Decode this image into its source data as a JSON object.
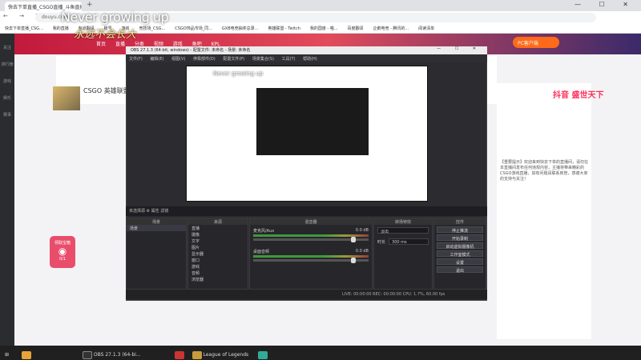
{
  "browser": {
    "tab_title": "快去下单直播_CSGO直播_斗鱼直播",
    "new_tab": "+",
    "window_controls": "— ☐ ✕",
    "nav_buttons": "← → ↻",
    "url": "douyu.com",
    "bookmarks": [
      "快去下单直播_CSG...",
      "我的直播",
      "有道翻译",
      "账号",
      "游戏",
      "竞技场_CSG...",
      "CSGO饰品市场_同...",
      "GXB电竞抽奖总录...",
      "英雄联盟 - Twitch",
      "我的国度 - 喵...",
      "百度翻译",
      "企鹅电竞 - 腾讯的...",
      "阅读清单"
    ]
  },
  "overlay": {
    "line1": "Never growing up",
    "line2": "永远不会长大"
  },
  "site": {
    "sidebar": [
      "关注",
      "排行榜",
      "游戏",
      "娱乐",
      "赛事"
    ],
    "nav": [
      "首页",
      "直播",
      "分类",
      "视频",
      "游戏",
      "鱼吧",
      "KPL"
    ],
    "pc_pill": "PC客户端",
    "streamer_name": "CSGO 英雄联盟 然",
    "ad_text": "抖音 盛世天下",
    "right_text": "【重要提示】欢迎来到快去下单的直播间，请勿在本直播间发布任何违规内容，主播将带来精彩的CSGO游戏直播，如有问题请联系房管，感谢大家的支持与关注！",
    "chest_label": "领取宝箱",
    "chest_count": "0/1"
  },
  "obs": {
    "title": "OBS 27.1.3 (64-bit, windows) - 配置文件: 未命名 - 场景: 未命名",
    "window_controls": "— ☐ ✕",
    "menu": [
      "文件(F)",
      "编辑(E)",
      "视图(V)",
      "停靠部件(D)",
      "配置文件(P)",
      "场景集合(S)",
      "工具(T)",
      "帮助(H)"
    ],
    "preview_overlay": "Never growing up",
    "context_bar": "未选择源     ⚙ 属性   滤镜",
    "docks": {
      "scenes": {
        "header": "场景",
        "items": [
          "场景"
        ]
      },
      "sources": {
        "header": "来源",
        "items": [
          "直播",
          "摄像",
          "文字",
          "图片",
          "显示器",
          "窗口",
          "游戏",
          "音频",
          "浏览器",
          "背景音乐"
        ]
      },
      "mixer": {
        "header": "混音器",
        "tracks": [
          {
            "name": "麦克风/Aux",
            "db": "0.0 dB",
            "level": 0.85
          },
          {
            "name": "桌面音频",
            "db": "0.0 dB",
            "level": 0.85
          }
        ]
      },
      "transitions": {
        "header": "转场特效",
        "type": "淡出",
        "duration_label": "时长",
        "duration": "300 ms"
      },
      "controls": {
        "header": "控件",
        "buttons": [
          "停止推流",
          "开始录制",
          "启动虚拟摄像机",
          "工作室模式",
          "设置",
          "退出"
        ]
      }
    },
    "status": "LIVE: 00:00:00   REC: 00:00:00   CPU: 1.7%, 60.00 fps"
  },
  "taskbar": {
    "items": [
      "",
      "OBS 27.1.3 (64-bi...",
      "",
      "League of Legends",
      ""
    ]
  }
}
